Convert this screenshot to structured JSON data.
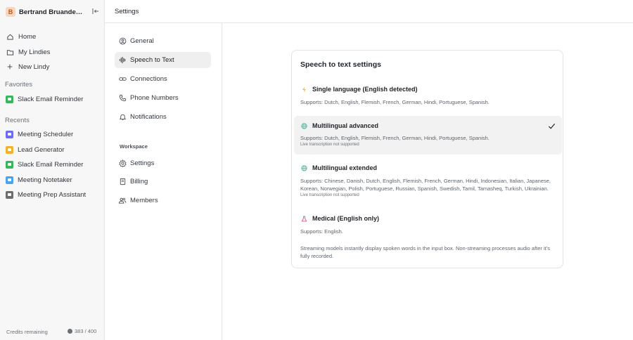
{
  "workspace": {
    "avatar_letter": "B",
    "name": "Bertrand Bruandet's..."
  },
  "sidebar": {
    "nav": [
      {
        "label": "Home",
        "icon": "home-icon"
      },
      {
        "label": "My Lindies",
        "icon": "folder-icon"
      },
      {
        "label": "New Lindy",
        "icon": "plus-icon"
      }
    ],
    "favorites_label": "Favorites",
    "favorites": [
      {
        "label": "Slack Email Reminder",
        "icon": "slack-email-reminder-icon",
        "color": "#3bb55d"
      }
    ],
    "recents_label": "Recents",
    "recents": [
      {
        "label": "Meeting Scheduler",
        "icon": "meeting-scheduler-icon",
        "color": "#6b6ef5"
      },
      {
        "label": "Lead Generator",
        "icon": "lead-generator-icon",
        "color": "#f1b32f"
      },
      {
        "label": "Slack Email Reminder",
        "icon": "slack-email-reminder-icon",
        "color": "#3bb55d"
      },
      {
        "label": "Meeting Notetaker",
        "icon": "meeting-notetaker-icon",
        "color": "#4aa3f0"
      },
      {
        "label": "Meeting Prep Assistant",
        "icon": "meeting-prep-icon",
        "color": "#6e6e6e"
      }
    ],
    "credits_label": "Credits remaining",
    "credits_value": "383 / 400"
  },
  "header": {
    "title": "Settings"
  },
  "settings_nav": {
    "items": [
      {
        "label": "General",
        "icon": "user-circle-icon"
      },
      {
        "label": "Speech to Text",
        "icon": "waveform-icon",
        "active": true
      },
      {
        "label": "Connections",
        "icon": "link-icon"
      },
      {
        "label": "Phone Numbers",
        "icon": "phone-icon"
      },
      {
        "label": "Notifications",
        "icon": "bell-icon"
      }
    ],
    "workspace_label": "Workspace",
    "workspace_items": [
      {
        "label": "Settings",
        "icon": "gear-icon"
      },
      {
        "label": "Billing",
        "icon": "receipt-icon"
      },
      {
        "label": "Members",
        "icon": "users-icon"
      }
    ]
  },
  "card": {
    "title": "Speech to text settings",
    "options": [
      {
        "name": "Single language (English detected)",
        "icon": "lightning-icon",
        "icon_color": "#f3c04a",
        "supports": "Supports: Dutch, English, Flemish, French, German, Hindi, Portuguese, Spanish.",
        "note": ""
      },
      {
        "name": "Multilingual advanced",
        "icon": "globe-icon",
        "icon_color": "#35b59b",
        "supports": "Supports: Dutch, English, Flemish, French, German, Hindi, Portuguese, Spanish.",
        "note": "Live transcription not supported",
        "selected": true
      },
      {
        "name": "Multilingual extended",
        "icon": "globe-icon",
        "icon_color": "#35b59b",
        "supports": "Supports: Chinese, Danish, Dutch, English, Flemish, French, German, Hindi, Indonesian, Italian, Japanese, Korean, Norwegian, Polish, Portuguese, Russian, Spanish, Swedish, Tamil, Tamasheq, Turkish, Ukrainian.",
        "note": "Live transcription not supported"
      },
      {
        "name": "Medical (English only)",
        "icon": "flask-icon",
        "icon_color": "#e0547a",
        "supports": "Supports: English.",
        "note": ""
      }
    ],
    "footer": "Streaming models instantly display spoken words in the input box. Non-streaming processes audio after it's fully recorded."
  }
}
